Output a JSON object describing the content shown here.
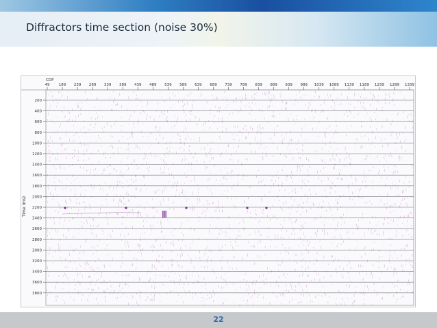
{
  "slide": {
    "title": "Diffractors time section (noise 30%)",
    "page_number": "22"
  },
  "section": {
    "cdp_label": "CDP",
    "time_axis_label": "Time (ms)",
    "cdp_ticks": [
      "49",
      "189",
      "239",
      "289",
      "339",
      "389",
      "439",
      "489",
      "539",
      "589",
      "639",
      "689",
      "739",
      "789",
      "839",
      "889",
      "939",
      "989",
      "1039",
      "1089",
      "1139",
      "1189",
      "1239",
      "1289",
      "1339"
    ],
    "time_ticks": [
      "200",
      "400",
      "600",
      "800",
      "1000",
      "1200",
      "1400",
      "1600",
      "1800",
      "2000",
      "2200",
      "2400",
      "2600",
      "2800",
      "3000",
      "3200",
      "3400",
      "3600",
      "3800"
    ],
    "noise_color": "#c98bc9",
    "grid_color": "#6e6e78",
    "diffractor_color": "#7a2c8c"
  }
}
